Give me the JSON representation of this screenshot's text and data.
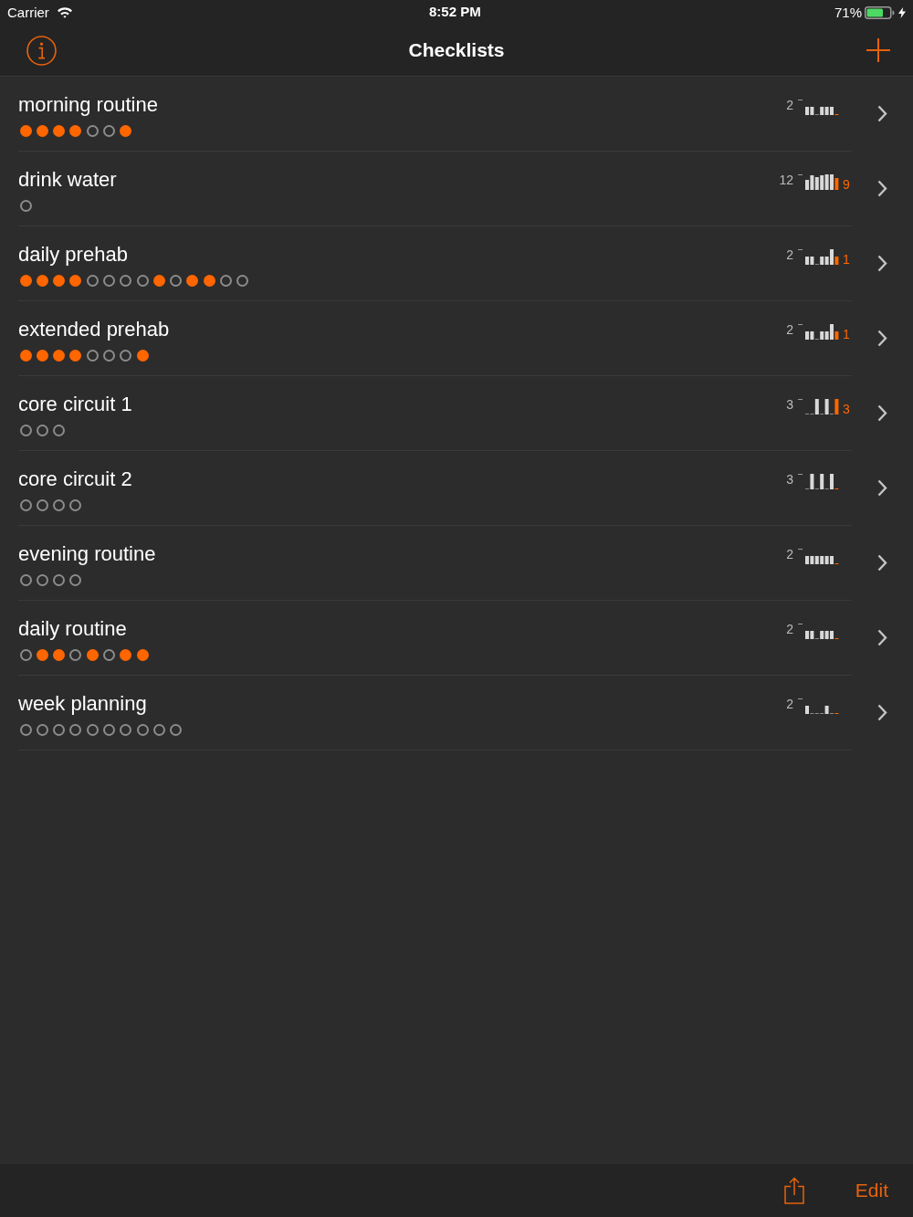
{
  "status_bar": {
    "carrier": "Carrier",
    "time": "8:52 PM",
    "battery": "71%"
  },
  "nav_bar": {
    "title": "Checklists"
  },
  "checklists": [
    {
      "name": "morning routine",
      "max_label": "2",
      "items": [
        {
          "checked": true
        },
        {
          "checked": true
        },
        {
          "checked": true
        },
        {
          "checked": true
        },
        {
          "checked": false
        },
        {
          "checked": false
        },
        {
          "checked": true
        }
      ]
    },
    {
      "name": "drink water",
      "max_label": "12",
      "today": "9",
      "items": [
        {
          "checked": false
        }
      ]
    },
    {
      "name": "daily prehab",
      "max_label": "2",
      "today": "1",
      "items": [
        {
          "checked": true
        },
        {
          "checked": true
        },
        {
          "checked": true
        },
        {
          "checked": true
        },
        {
          "checked": false
        },
        {
          "checked": false
        },
        {
          "checked": false
        },
        {
          "checked": false
        },
        {
          "checked": true
        },
        {
          "checked": false
        },
        {
          "checked": true
        },
        {
          "checked": true
        },
        {
          "checked": false
        },
        {
          "checked": false
        }
      ]
    },
    {
      "name": "extended prehab",
      "max_label": "2",
      "today": "1",
      "items": [
        {
          "checked": true
        },
        {
          "checked": true
        },
        {
          "checked": true
        },
        {
          "checked": true
        },
        {
          "checked": false
        },
        {
          "checked": false
        },
        {
          "checked": false
        },
        {
          "checked": true
        }
      ]
    },
    {
      "name": "core circuit 1",
      "max_label": "3",
      "today": "3",
      "items": [
        {
          "checked": false
        },
        {
          "checked": false
        },
        {
          "checked": false
        }
      ]
    },
    {
      "name": "core circuit 2",
      "max_label": "3",
      "items": [
        {
          "checked": false
        },
        {
          "checked": false
        },
        {
          "checked": false
        },
        {
          "checked": false
        }
      ]
    },
    {
      "name": "evening routine",
      "max_label": "2",
      "items": [
        {
          "checked": false
        },
        {
          "checked": false
        },
        {
          "checked": false
        },
        {
          "checked": false
        }
      ]
    },
    {
      "name": "daily routine",
      "max_label": "2",
      "items": [
        {
          "checked": false
        },
        {
          "checked": true
        },
        {
          "checked": true
        },
        {
          "checked": false
        },
        {
          "checked": true
        },
        {
          "checked": false
        },
        {
          "checked": true
        },
        {
          "checked": true
        }
      ]
    },
    {
      "name": "week planning",
      "max_label": "2",
      "items": [
        {
          "checked": false
        },
        {
          "checked": false
        },
        {
          "checked": false
        },
        {
          "checked": false
        },
        {
          "checked": false
        },
        {
          "checked": false
        },
        {
          "checked": false
        },
        {
          "checked": false
        },
        {
          "checked": false
        },
        {
          "checked": false
        }
      ]
    }
  ],
  "toolbar": {
    "edit": "Edit"
  }
}
